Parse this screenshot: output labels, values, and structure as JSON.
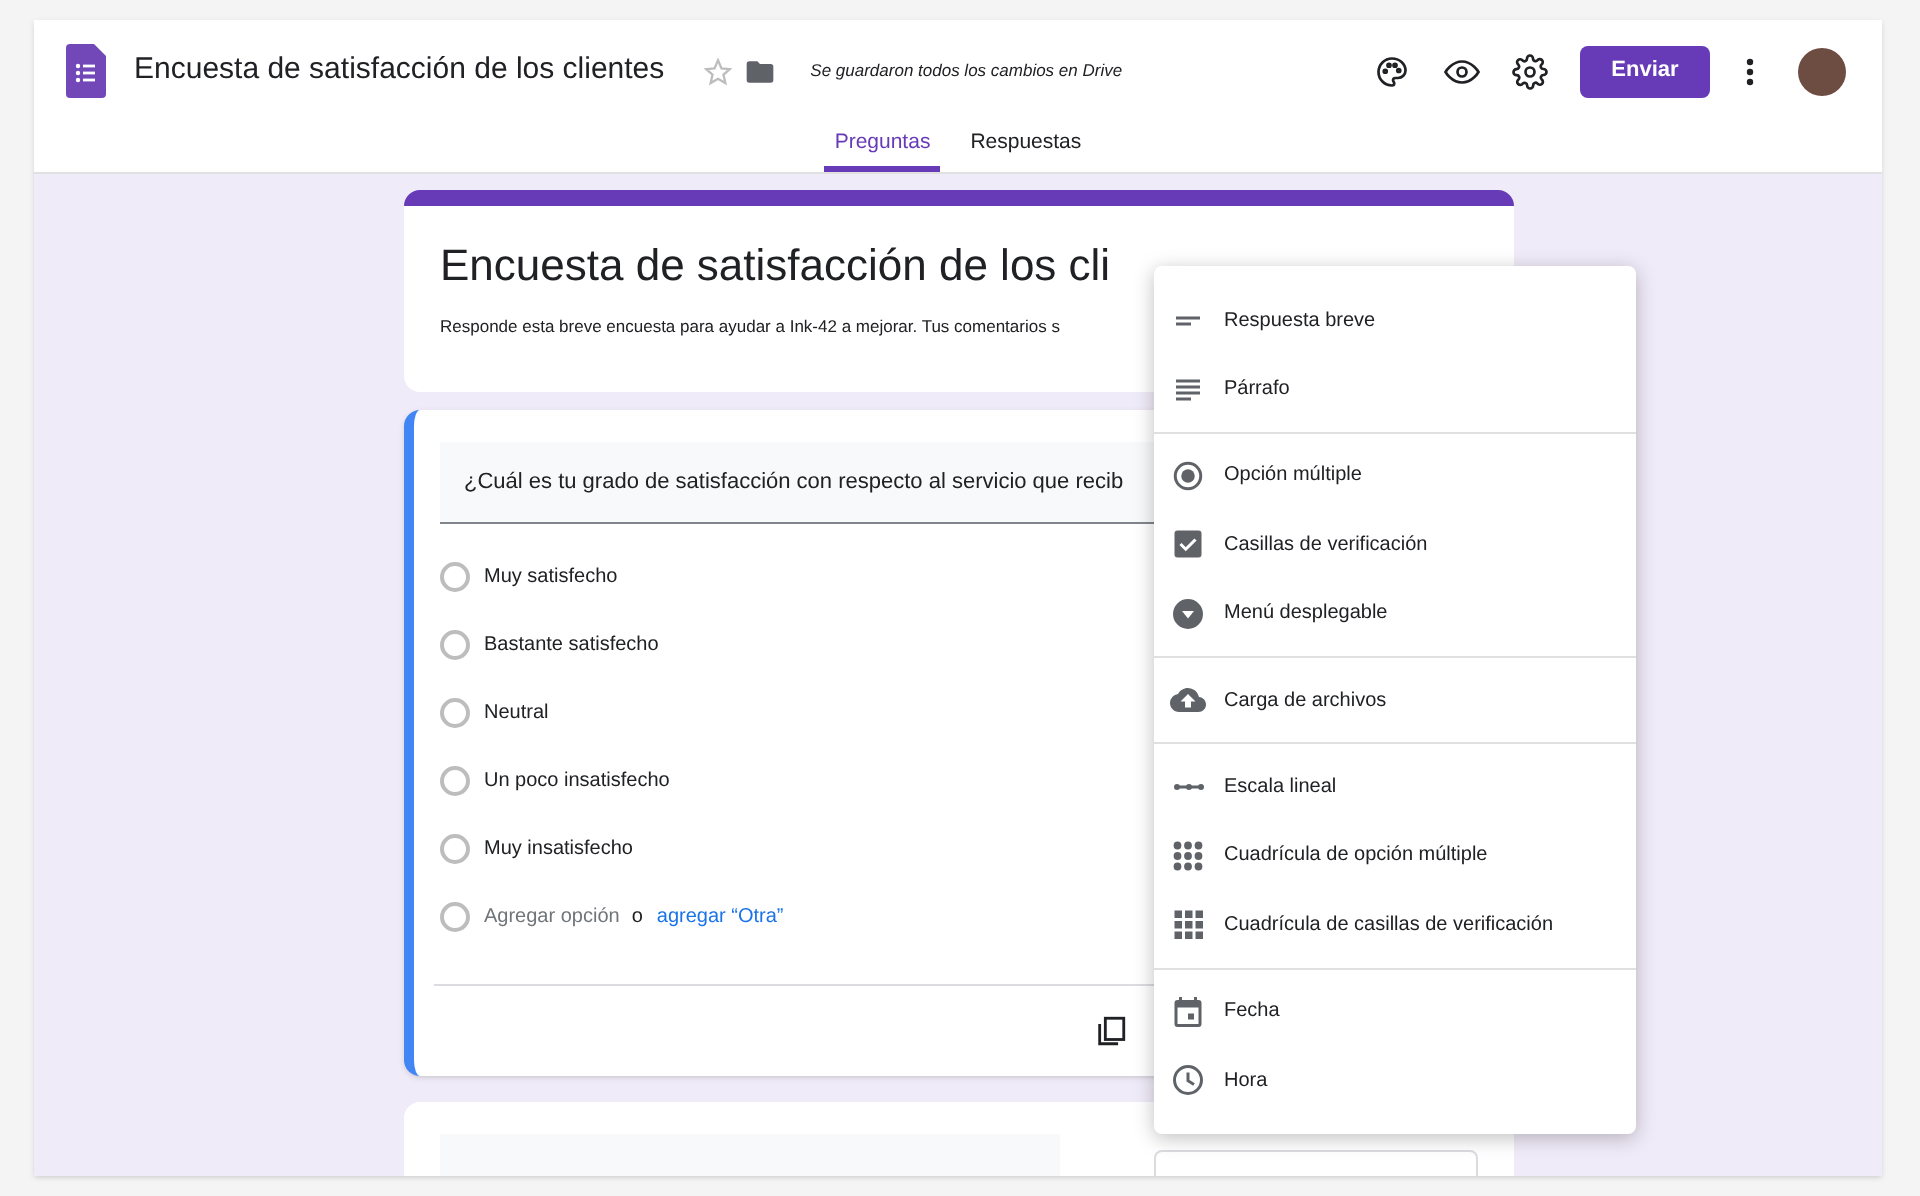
{
  "header": {
    "title": "Encuesta de satisfacción de los clientes",
    "starred": false,
    "saved_status": "Se guardaron todos los cambios en Drive",
    "send_button": "Enviar"
  },
  "tabs": [
    {
      "label": "Preguntas",
      "selected": true
    },
    {
      "label": "Respuestas",
      "selected": false
    }
  ],
  "form": {
    "title": "Encuesta de satisfacción de los cli",
    "description": "Responde esta breve encuesta para ayudar a Ink-42 a mejorar. Tus comentarios s"
  },
  "question": {
    "text": "¿Cuál es tu grado de satisfacción con respecto al servicio que recib",
    "options": [
      {
        "label": "Muy satisfecho",
        "selected": false
      },
      {
        "label": "Bastante satisfecho",
        "selected": false
      },
      {
        "label": "Neutral",
        "selected": false
      },
      {
        "label": "Un poco insatisfecho",
        "selected": false
      },
      {
        "label": "Muy insatisfecho",
        "selected": false
      }
    ],
    "add_option": "Agregar opción",
    "separator": "o",
    "add_other": "agregar “Otra”"
  },
  "menu": {
    "groups": [
      [
        {
          "label": "Respuesta breve",
          "kind": "short"
        },
        {
          "label": "Párrafo",
          "kind": "paragraph"
        }
      ],
      [
        {
          "label": "Opción múltiple",
          "kind": "radio"
        },
        {
          "label": "Casillas de verificación",
          "kind": "checkbox"
        },
        {
          "label": "Menú desplegable",
          "kind": "dropdown"
        }
      ],
      [
        {
          "label": "Carga de archivos",
          "kind": "upload"
        }
      ],
      [
        {
          "label": "Escala lineal",
          "kind": "scale"
        },
        {
          "label": "Cuadrícula de opción múltiple",
          "kind": "dotgrid"
        },
        {
          "label": "Cuadrícula de casillas de verificación",
          "kind": "boxgrid"
        }
      ],
      [
        {
          "label": "Fecha",
          "kind": "date"
        },
        {
          "label": "Hora",
          "kind": "time"
        }
      ]
    ]
  }
}
